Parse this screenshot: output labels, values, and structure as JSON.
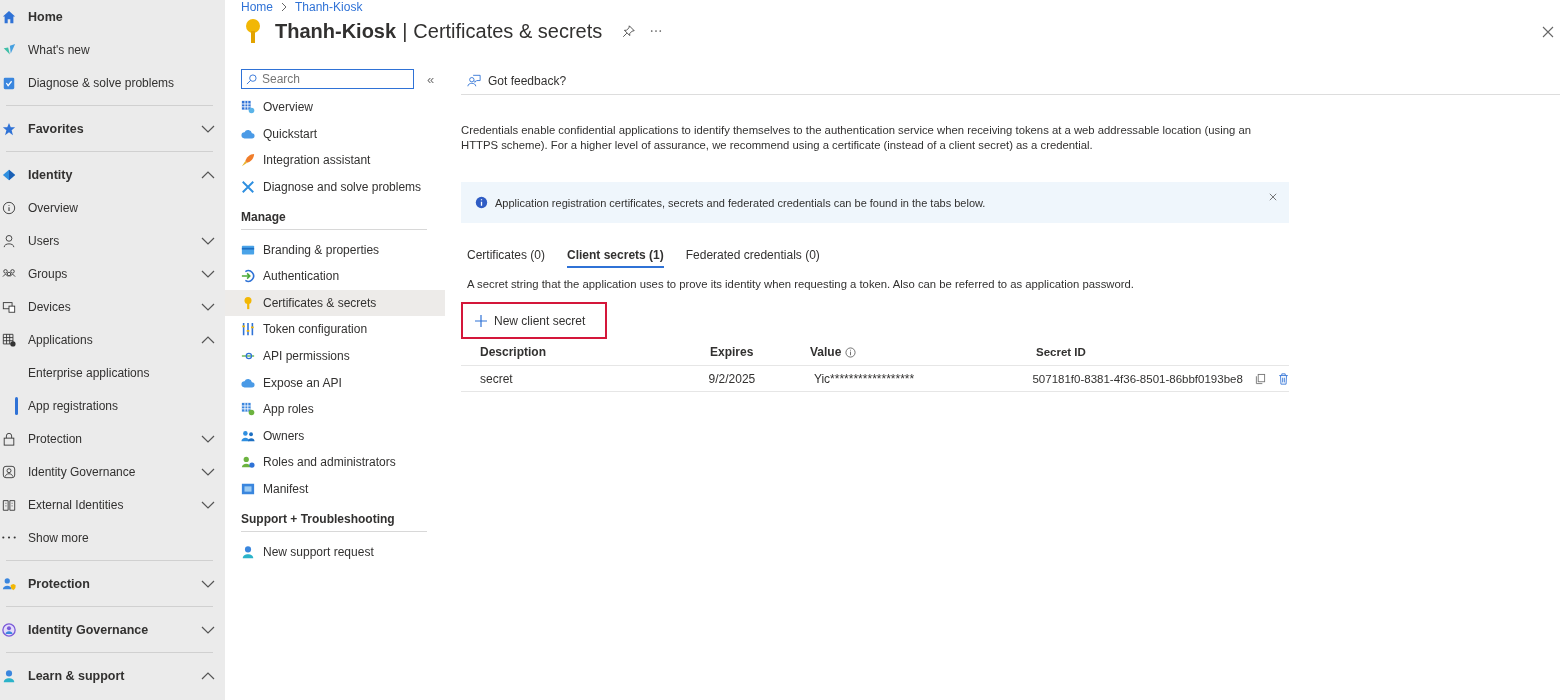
{
  "sidebar": {
    "groups": [
      [
        {
          "label": "Home",
          "kind": "heading",
          "selected": false
        },
        {
          "label": "What's new",
          "kind": "link",
          "selected": false
        },
        {
          "label": "Diagnose & solve problems",
          "kind": "link",
          "selected": false
        }
      ],
      [
        {
          "label": "Favorites",
          "kind": "heading",
          "selected": false,
          "expanded": false
        }
      ],
      [
        {
          "label": "Identity",
          "kind": "heading",
          "selected": false,
          "expanded": true,
          "children": [
            {
              "label": "Overview",
              "kind": "link",
              "selected": false
            },
            {
              "label": "Users",
              "kind": "link",
              "selected": false,
              "expanded": false
            },
            {
              "label": "Groups",
              "kind": "link",
              "selected": false,
              "expanded": false
            },
            {
              "label": "Devices",
              "kind": "link",
              "selected": false,
              "expanded": false
            },
            {
              "label": "Applications",
              "kind": "link",
              "selected": false,
              "expanded": true,
              "children": [
                {
                  "label": "Enterprise applications",
                  "kind": "link",
                  "selected": false
                },
                {
                  "label": "App registrations",
                  "kind": "link",
                  "selected": true
                }
              ]
            },
            {
              "label": "Protection",
              "kind": "link",
              "selected": false,
              "expanded": false
            },
            {
              "label": "Identity Governance",
              "kind": "link",
              "selected": false,
              "expanded": false
            },
            {
              "label": "External Identities",
              "kind": "link",
              "selected": false,
              "expanded": false
            },
            {
              "label": "Show more",
              "kind": "link",
              "selected": false
            }
          ]
        }
      ],
      [
        {
          "label": "Protection",
          "kind": "heading",
          "selected": false,
          "expanded": false
        }
      ],
      [
        {
          "label": "Identity Governance",
          "kind": "heading",
          "selected": false,
          "expanded": false
        }
      ],
      [
        {
          "label": "Learn & support",
          "kind": "heading",
          "selected": false,
          "expanded": true
        }
      ]
    ]
  },
  "breadcrumb": [
    "Home",
    "Thanh-Kiosk"
  ],
  "title": {
    "name": "Thanh-Kiosk",
    "separator": "|",
    "page": "Certificates & secrets"
  },
  "menu": {
    "search": {
      "placeholder": "Search"
    },
    "collapse": "«",
    "sections": [
      {
        "items": [
          {
            "label": "Overview",
            "selected": false
          },
          {
            "label": "Quickstart",
            "selected": false
          },
          {
            "label": "Integration assistant",
            "selected": false
          },
          {
            "label": "Diagnose and solve problems",
            "selected": false
          }
        ]
      },
      {
        "heading": "Manage",
        "items": [
          {
            "label": "Branding & properties",
            "selected": false
          },
          {
            "label": "Authentication",
            "selected": false
          },
          {
            "label": "Certificates & secrets",
            "selected": true
          },
          {
            "label": "Token configuration",
            "selected": false
          },
          {
            "label": "API permissions",
            "selected": false
          },
          {
            "label": "Expose an API",
            "selected": false
          },
          {
            "label": "App roles",
            "selected": false
          },
          {
            "label": "Owners",
            "selected": false
          },
          {
            "label": "Roles and administrators",
            "selected": false
          },
          {
            "label": "Manifest",
            "selected": false
          }
        ]
      },
      {
        "heading": "Support + Troubleshooting",
        "items": [
          {
            "label": "New support request",
            "selected": false
          }
        ]
      }
    ]
  },
  "feedback": "Got feedback?",
  "intro": "Credentials enable confidential applications to identify themselves to the authentication service when receiving tokens at a web addressable location (using an HTTPS scheme). For a higher level of assurance, we recommend using a certificate (instead of a client secret) as a credential.",
  "banner": "Application registration certificates, secrets and federated credentials can be found in the tabs below.",
  "tabs": [
    {
      "label": "Certificates (0)",
      "selected": false
    },
    {
      "label": "Client secrets (1)",
      "selected": true
    },
    {
      "label": "Federated credentials (0)",
      "selected": false
    }
  ],
  "tab_description": "A secret string that the application uses to prove its identity when requesting a token. Also can be referred to as application password.",
  "new_button": {
    "label": "New client secret",
    "highlighted": true
  },
  "table": {
    "columns": [
      {
        "label": "Description"
      },
      {
        "label": "Expires"
      },
      {
        "label": "Value",
        "info": true
      },
      {
        "label": "Secret ID"
      }
    ],
    "rows": [
      {
        "cells": [
          "secret",
          "9/2/2025",
          "Yic******************",
          "507181f0-8381-4f36-8501-86bbf0193be8"
        ]
      }
    ]
  }
}
